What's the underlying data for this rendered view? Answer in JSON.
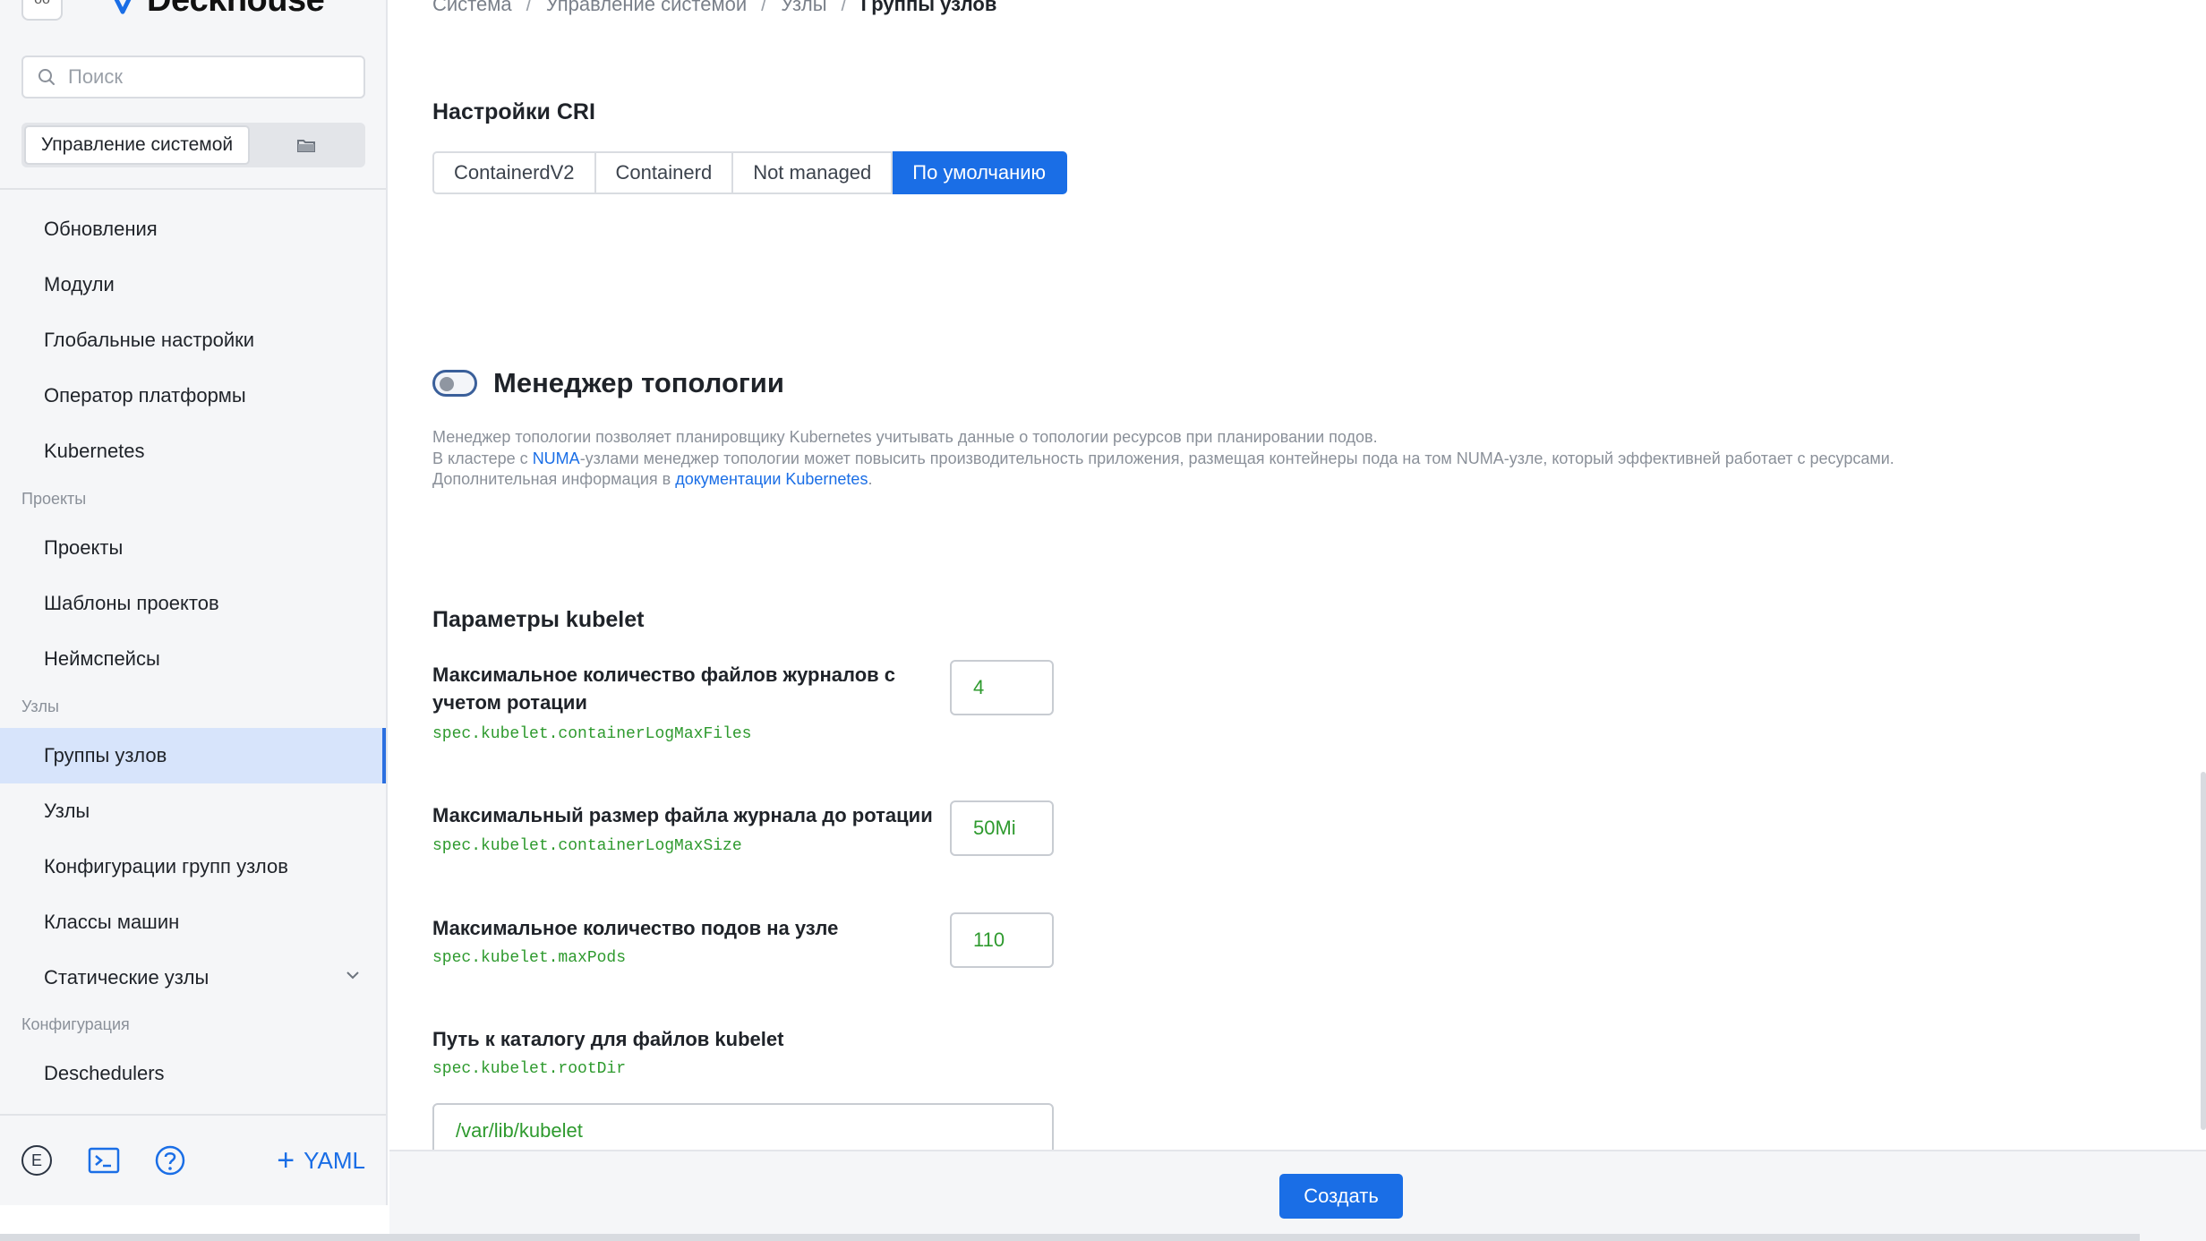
{
  "app": {
    "logo_text": "Deckhouse",
    "logo_box_label": "oo"
  },
  "search": {
    "placeholder": "Поиск"
  },
  "switcher": {
    "active_label": "Управление системой"
  },
  "sidebar": {
    "items": [
      {
        "label": "Обновления"
      },
      {
        "label": "Модули"
      },
      {
        "label": "Глобальные настройки"
      },
      {
        "label": "Оператор платформы"
      },
      {
        "label": "Kubernetes"
      },
      {
        "label": "Проекты"
      },
      {
        "label": "Шаблоны проектов"
      },
      {
        "label": "Неймспейсы"
      },
      {
        "label": "Группы узлов"
      },
      {
        "label": "Узлы"
      },
      {
        "label": "Конфигурации групп узлов"
      },
      {
        "label": "Классы машин"
      },
      {
        "label": "Статические узлы"
      },
      {
        "label": "Deschedulers"
      }
    ],
    "sections": [
      "Проекты",
      "Узлы",
      "Конфигурация"
    ],
    "footer": {
      "avatar_letter": "E",
      "yaml_label": "YAML"
    }
  },
  "breadcrumb": [
    "Система",
    "Управление системой",
    "Узлы",
    "Группы узлов"
  ],
  "cri": {
    "title": "Настройки CRI",
    "options": [
      "ContainerdV2",
      "Containerd",
      "Not managed",
      "По умолчанию"
    ],
    "selected": "По умолчанию"
  },
  "topology": {
    "title": "Менеджер топологии",
    "enabled": false,
    "line1": "Менеджер топологии позволяет планировщику Kubernetes учитывать данные о топологии ресурсов при планировании подов.",
    "line2_prefix": "В кластере с ",
    "line2_link": "NUMA",
    "line2_suffix": "-узлами менеджер топологии может повысить производительность приложения, размещая контейнеры пода на том NUMA-узле, который эффективней работает с ресурсами.",
    "line3_prefix": "Дополнительная информация в ",
    "line3_link": "документации Kubernetes",
    "line3_suffix": "."
  },
  "kubelet": {
    "title": "Параметры kubelet",
    "fields": [
      {
        "label_line1": "Максимальное количество файлов журналов с",
        "label_line2": "учетом ротации",
        "path": "spec.kubelet.containerLogMaxFiles",
        "value": "4"
      },
      {
        "label": "Максимальный размер файла журнала до ротации",
        "path": "spec.kubelet.containerLogMaxSize",
        "value": "50Mi"
      },
      {
        "label": "Максимальное количество подов на узле",
        "path": "spec.kubelet.maxPods",
        "value": "110"
      },
      {
        "label": "Путь к каталогу для файлов kubelet",
        "path": "spec.kubelet.rootDir",
        "value": "/var/lib/kubelet"
      }
    ]
  },
  "footer": {
    "create_label": "Создать"
  },
  "colors": {
    "accent": "#1a6ee6",
    "value_green": "#2e9a2e",
    "active_nav_bg": "#d7e4fb"
  }
}
